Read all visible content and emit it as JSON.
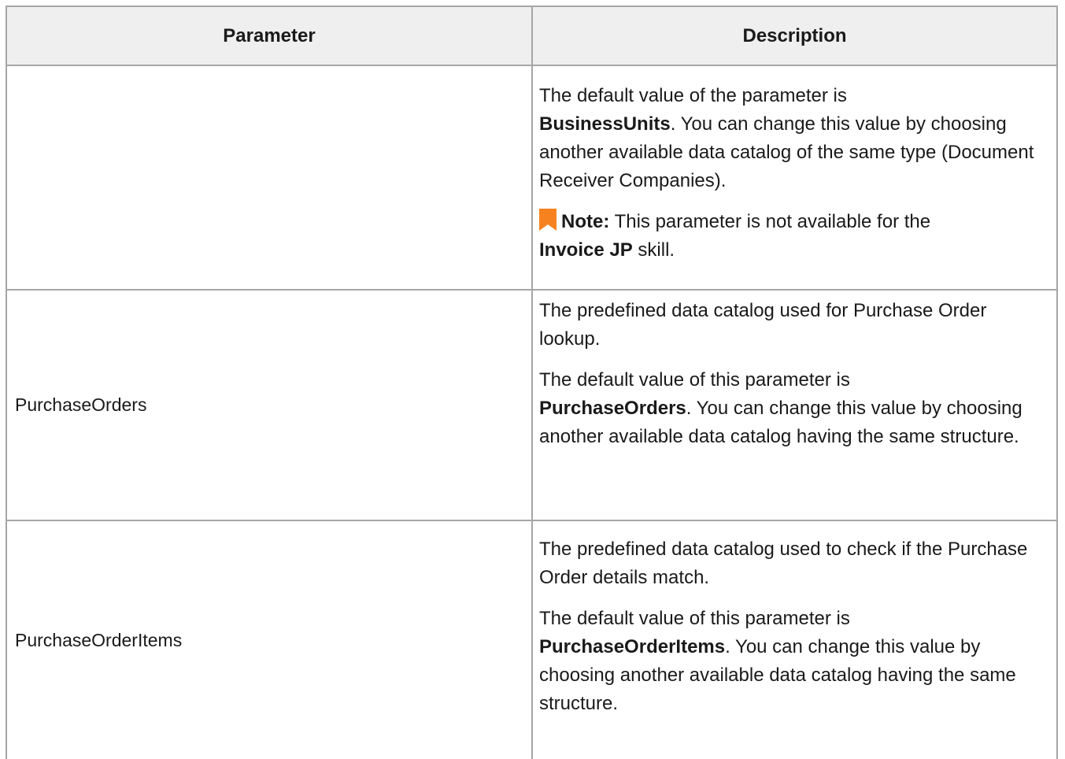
{
  "table": {
    "headers": {
      "parameter": "Parameter",
      "description": "Description"
    },
    "rows": [
      {
        "parameter": "",
        "desc_p1_a": "The default value of the parameter is",
        "desc_p1_bold": "BusinessUnits",
        "desc_p1_b": ". You can change this value by choosing another available data catalog of the same type (Document Receiver Companies).",
        "note_label": "Note:",
        "note_a": " This parameter is not available for the",
        "note_bold": "Invoice JP",
        "note_b": " skill."
      },
      {
        "parameter": "PurchaseOrders",
        "desc_p1": "The predefined data catalog used for Purchase Order lookup.",
        "desc_p2_a": "The default value of this parameter is",
        "desc_p2_bold": "PurchaseOrders",
        "desc_p2_b": ". You can change this value by choosing another available data catalog having the same structure."
      },
      {
        "parameter": "PurchaseOrderItems",
        "desc_p1": "The predefined data catalog used to check if the Purchase Order details match.",
        "desc_p2_a": "The default value of this parameter is",
        "desc_p2_bold": "PurchaseOrderItems",
        "desc_p2_b": ". You can change this value by choosing another available data catalog having the same structure."
      }
    ],
    "colors": {
      "border": "#a6a6a6",
      "header_bg": "#efefef",
      "note_icon": "#f5821f"
    }
  }
}
